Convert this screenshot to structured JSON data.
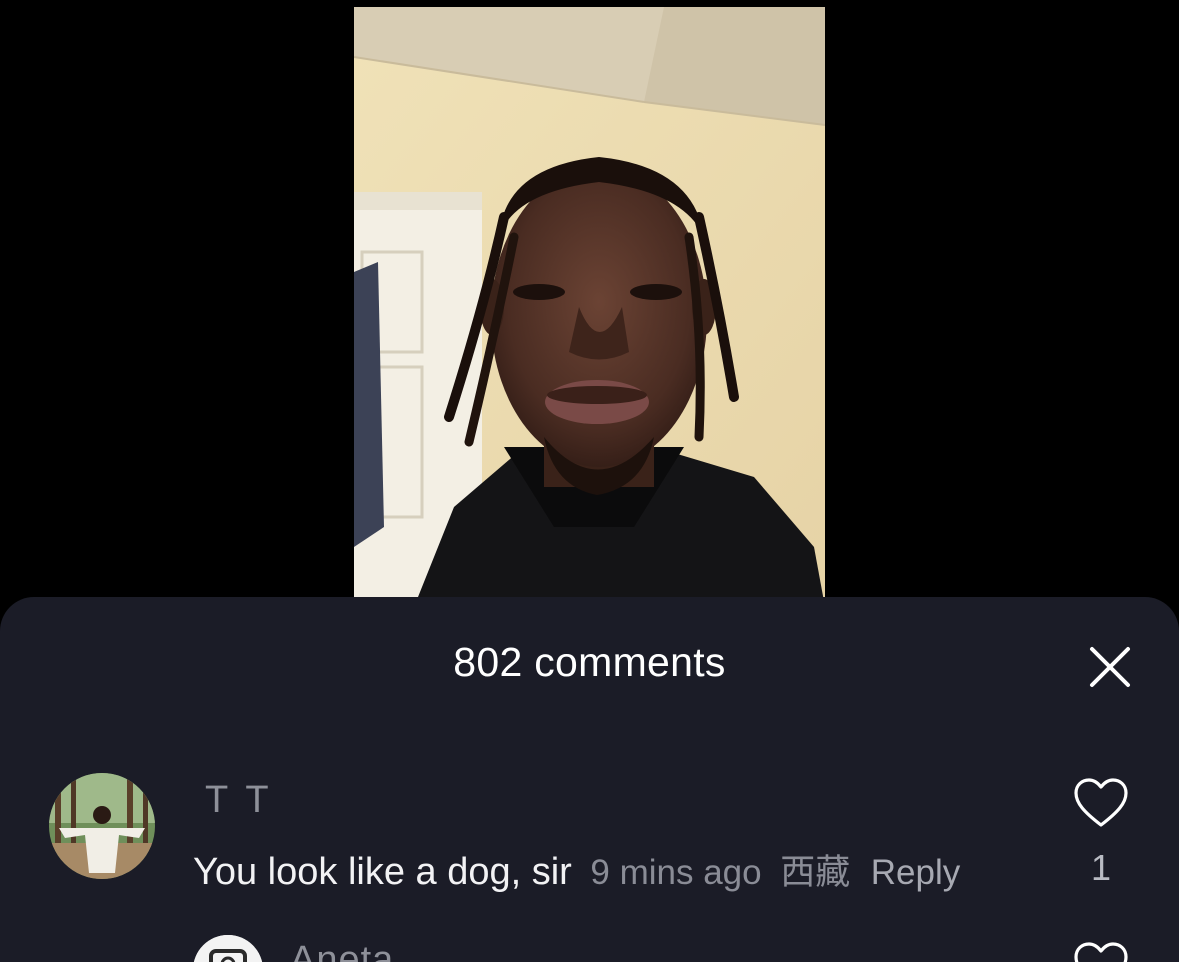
{
  "sheet": {
    "title": "802 comments"
  },
  "comments": [
    {
      "author": "T T",
      "text": "You look like a dog, sir",
      "time": "9 mins ago",
      "location": "西藏",
      "reply_label": "Reply",
      "likes": "1"
    },
    {
      "author": "Aneta"
    }
  ],
  "icons": {
    "close": "close-icon",
    "like": "heart-outline-icon"
  },
  "colors": {
    "sheet_background": "#1b1c27",
    "primary_text": "#ffffff",
    "secondary_text": "#8a8c96"
  }
}
